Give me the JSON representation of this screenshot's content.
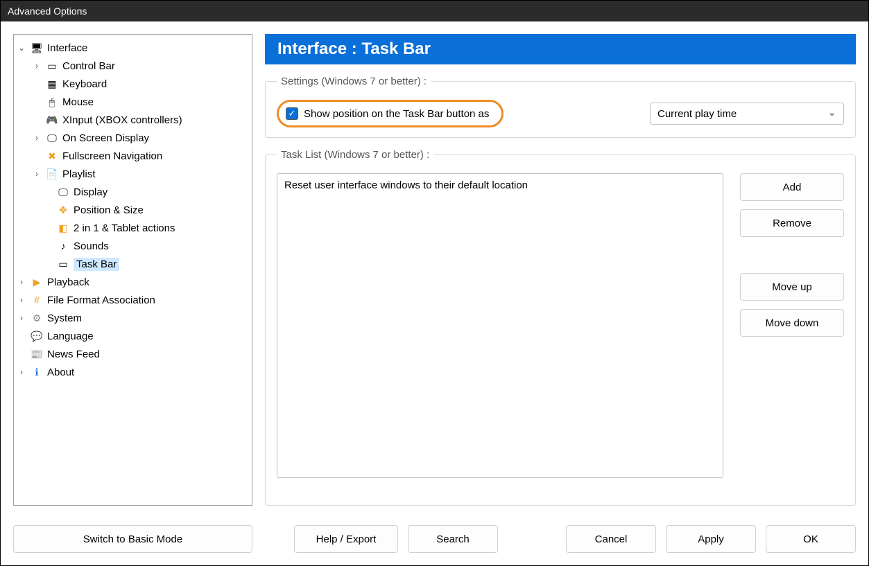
{
  "window": {
    "title": "Advanced Options"
  },
  "tree": {
    "items": [
      {
        "label": "Interface",
        "level": 0,
        "expander": "⌄",
        "icon": "🖥"
      },
      {
        "label": "Control Bar",
        "level": 1,
        "expander": "›",
        "icon": "▭"
      },
      {
        "label": "Keyboard",
        "level": 1,
        "expander": "",
        "icon": "▦"
      },
      {
        "label": "Mouse",
        "level": 1,
        "expander": "",
        "icon": "🖱"
      },
      {
        "label": "XInput (XBOX controllers)",
        "level": 1,
        "expander": "",
        "icon": "🎮"
      },
      {
        "label": "On Screen Display",
        "level": 1,
        "expander": "›",
        "icon": "🖵"
      },
      {
        "label": "Fullscreen Navigation",
        "level": 1,
        "expander": "",
        "icon": "✖"
      },
      {
        "label": "Playlist",
        "level": 1,
        "expander": "›",
        "icon": "📄"
      },
      {
        "label": "Display",
        "level": 2,
        "expander": "",
        "icon": "🖵"
      },
      {
        "label": "Position & Size",
        "level": 2,
        "expander": "",
        "icon": "✥"
      },
      {
        "label": "2 in 1 & Tablet actions",
        "level": 2,
        "expander": "",
        "icon": "◧"
      },
      {
        "label": "Sounds",
        "level": 2,
        "expander": "",
        "icon": "♪"
      },
      {
        "label": "Task Bar",
        "level": 2,
        "expander": "",
        "icon": "▭",
        "selected": true
      },
      {
        "label": "Playback",
        "level": 0,
        "expander": "›",
        "icon": "▶"
      },
      {
        "label": "File Format Association",
        "level": 0,
        "expander": "›",
        "icon": "#"
      },
      {
        "label": "System",
        "level": 0,
        "expander": "›",
        "icon": "⚙"
      },
      {
        "label": "Language",
        "level": 0,
        "expander": "",
        "icon": "💬"
      },
      {
        "label": "News Feed",
        "level": 0,
        "expander": "",
        "icon": "📰"
      },
      {
        "label": "About",
        "level": 0,
        "expander": "›",
        "icon": "ℹ"
      }
    ]
  },
  "main": {
    "heading": "Interface : Task Bar",
    "settings_legend": "Settings (Windows 7 or better) :",
    "show_position_label": "Show position on the Task Bar button as",
    "show_position_checked": true,
    "duration_mode": "Current play time",
    "tasklist_legend": "Task List (Windows 7 or better) :",
    "task_items": [
      "Reset user interface windows to their default location"
    ],
    "buttons": {
      "add": "Add",
      "remove": "Remove",
      "move_up": "Move up",
      "move_down": "Move down"
    }
  },
  "bottom": {
    "basic": "Switch to Basic Mode",
    "help": "Help / Export",
    "search": "Search",
    "cancel": "Cancel",
    "apply": "Apply",
    "ok": "OK"
  }
}
